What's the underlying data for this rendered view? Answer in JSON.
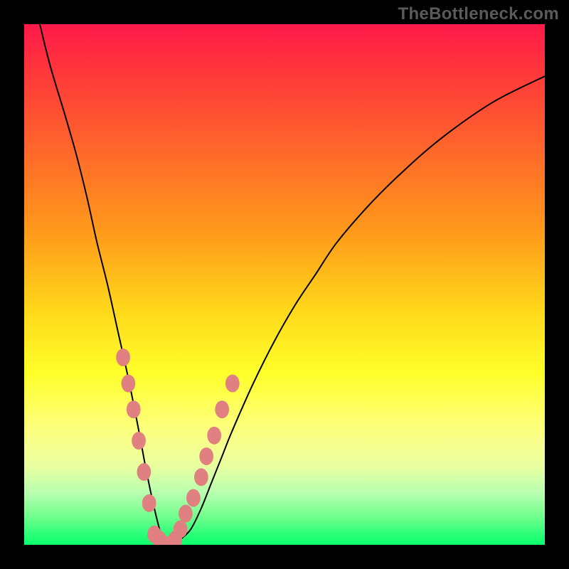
{
  "watermark": "TheBottleneck.com",
  "colors": {
    "background": "#000000",
    "curve": "#000000",
    "markers": "#e08080",
    "gradient_stops": [
      {
        "pos": 0.0,
        "hex": "#ff1a4a"
      },
      {
        "pos": 0.1,
        "hex": "#ff3a3a"
      },
      {
        "pos": 0.25,
        "hex": "#ff6a2a"
      },
      {
        "pos": 0.4,
        "hex": "#ff9a1a"
      },
      {
        "pos": 0.55,
        "hex": "#ffd81a"
      },
      {
        "pos": 0.67,
        "hex": "#ffff2a"
      },
      {
        "pos": 0.75,
        "hex": "#ffff6a"
      },
      {
        "pos": 0.8,
        "hex": "#f8ff8a"
      },
      {
        "pos": 0.85,
        "hex": "#e8ffa0"
      },
      {
        "pos": 0.9,
        "hex": "#b8ffb0"
      },
      {
        "pos": 0.95,
        "hex": "#6aff8a"
      },
      {
        "pos": 0.98,
        "hex": "#2aff7a"
      },
      {
        "pos": 1.0,
        "hex": "#0aff6a"
      }
    ]
  },
  "chart_data": {
    "type": "line",
    "title": "",
    "xlabel": "",
    "ylabel": "",
    "xlim": [
      0,
      100
    ],
    "ylim": [
      0,
      100
    ],
    "grid": false,
    "series": [
      {
        "name": "curve",
        "x": [
          3,
          5,
          8,
          10,
          12,
          14,
          16,
          18,
          20,
          22,
          23.5,
          25,
          26,
          27,
          28,
          29,
          30,
          32,
          34,
          36,
          38,
          40,
          44,
          48,
          52,
          56,
          60,
          66,
          72,
          80,
          90,
          100
        ],
        "y": [
          100,
          92,
          82,
          75,
          67,
          58,
          50,
          41,
          32,
          22,
          14,
          7,
          3,
          0,
          0,
          0,
          1,
          3,
          7,
          12,
          17,
          22,
          31,
          39,
          46,
          52,
          58,
          65,
          71,
          78,
          85,
          90
        ]
      }
    ],
    "markers_left": {
      "x": [
        19,
        20,
        21,
        22,
        23,
        24
      ],
      "y": [
        36,
        31,
        26,
        20,
        14,
        8
      ]
    },
    "markers_right": {
      "x": [
        30,
        31,
        32.5,
        34,
        35,
        36.5,
        38,
        40
      ],
      "y": [
        3,
        6,
        9,
        13,
        17,
        21,
        26,
        31
      ]
    },
    "markers_bottom": {
      "x": [
        25,
        26,
        27,
        28,
        29
      ],
      "y": [
        2,
        1,
        0,
        0,
        1
      ]
    }
  }
}
